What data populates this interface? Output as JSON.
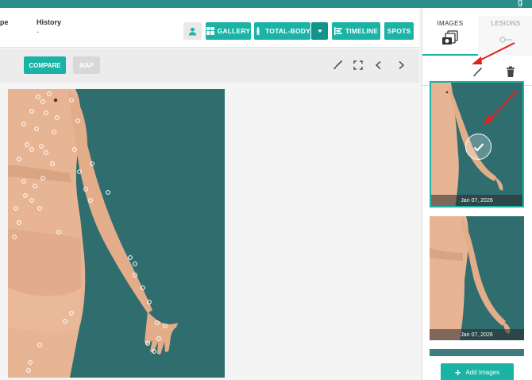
{
  "header": {
    "type_label_partial": "pe",
    "history_label": "History",
    "history_value": "-"
  },
  "toolbar": {
    "gallery_label": "GALLERY",
    "total_body_label": "TOTAL-BODY",
    "timeline_label": "TIMELINE",
    "spots_label": "SPOTS",
    "compare_label": "COMPARE",
    "map_label": "MAP"
  },
  "sidebar": {
    "tabs": [
      {
        "label": "IMAGES",
        "icon": "photo-album-icon"
      },
      {
        "label": "LESIONS",
        "icon": "lesion-icon"
      }
    ],
    "thumbnails": [
      {
        "date": "Jan 07, 2026",
        "selected": true
      },
      {
        "date": "Jan 07, 2026",
        "selected": false
      }
    ],
    "add_images_label": "Add Images"
  },
  "colors": {
    "accent": "#1ab3a6",
    "backdrop": "#2f6d6f",
    "skin": "#e8b594",
    "annotation_arrow": "#e02020"
  }
}
